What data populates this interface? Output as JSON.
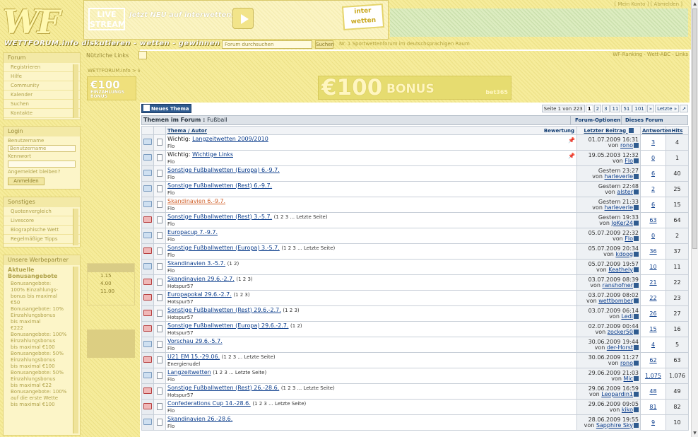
{
  "header": {
    "logo_text": "WF",
    "tagline": "WETTFORUM.info diskutieren - wetten - gewinnen",
    "live_stream": "LIVE STREAM",
    "promo_text": "Jetzt NEU auf interwetten.com",
    "interwetten": "inter wetten",
    "user_links": "[ Mein Konto ]   [ Abmelden ]"
  },
  "navbar": {
    "search_placeholder": "Forum durchsuchen",
    "search_button": "Suchen",
    "slogan": "Nr. 1 Sportwettenforum im deutschsprachigen Raum"
  },
  "sidebar": {
    "forum_title": "Forum",
    "forum_items": [
      "Registrieren",
      "Hilfe",
      "Community",
      "Kalender",
      "Suchen",
      "Kontakte"
    ],
    "login_title": "Login",
    "username_label": "Benutzername",
    "username_placeholder": "Benutzername",
    "password_label": "Kennwort",
    "remember_label": "Angemeldet bleiben?",
    "login_button": "Anmelden",
    "extras_title": "Sonstiges",
    "extras_items": [
      "Quotenvergleich",
      "Livescore",
      "Biographische Wett",
      "Regelmäßige Tipps"
    ],
    "offers_title": "Unsere Werbepartner",
    "offers_heading": "Aktuelle Bonusangebote",
    "offers_lines": [
      "Bonusangebote:",
      "100% Einzahlungs-",
      "bonus bis maximal",
      "€50",
      "Bonusangebote: 10%",
      "Einzahlungsbonus",
      "bis maximal",
      "€222",
      "Bonusangebote: 100%",
      "Einzahlungsbonus",
      "bis maximal €100",
      "Bonusangebote: 50%",
      "Einzahlungsbonus",
      "bis maximal €100",
      "Bonusangebote: 50%",
      "Einzahlungsbonus",
      "bis maximal €22",
      "Bonusangebote: 100%",
      "auf die erste Wette",
      "bis maximal €100"
    ]
  },
  "midcol": {
    "link_bar": "Nützliche Links",
    "bonus_amount": "€100",
    "bonus_text": "EINZAHLUNGS BONUS",
    "poll_options": [
      "1.15",
      "4.00",
      "11.00"
    ]
  },
  "breadcrumb": {
    "text": "WETTFORUM.info > Wettforum > Fußball",
    "top_links": "WF-Ranking - Wett-ABC - Links"
  },
  "banner": {
    "amount": "€100",
    "bonus": "BONUS",
    "brand": "bet365"
  },
  "forum": {
    "new_thread": "Neues Thema",
    "pager": {
      "info": "Seite 1 von 223",
      "pages": [
        "1",
        "2",
        "3",
        "11",
        "51",
        "101"
      ],
      "next": "»",
      "last": "Letzte »"
    },
    "title_prefix": "Themen im Forum",
    "title_forum": "Fußball",
    "options": "Forum-Optionen",
    "search": "Dieses Forum durchsuchen",
    "columns": {
      "topic": "Thema",
      "author": "Autor",
      "rating": "Bewertung",
      "last_post": "Letzter Beitrag",
      "replies": "Antworten",
      "views": "Hits"
    },
    "threads": [
      {
        "prefix": "Wichtig:",
        "title": "Langzeitwetten 2009/2010",
        "author": "Flo",
        "pages": "",
        "last_date": "01.07.2009 16:31",
        "last_by": "von",
        "last_user": "rono",
        "replies": "3",
        "views": "4",
        "hot": false,
        "sticky": true,
        "visited": false
      },
      {
        "prefix": "Wichtig:",
        "title": "Wichtige Links",
        "author": "Flo",
        "pages": "",
        "last_date": "19.05.2003 12:32",
        "last_by": "von",
        "last_user": "Flo",
        "replies": "0",
        "views": "1",
        "hot": false,
        "sticky": true,
        "visited": false
      },
      {
        "prefix": "",
        "title": "Sonstige Fußballwetten (Europa) 6.-9.7.",
        "author": "Flo",
        "pages": "",
        "last_date": "Gestern 23:27",
        "last_by": "von",
        "last_user": "harleverle",
        "replies": "6",
        "views": "40",
        "hot": false,
        "sticky": false,
        "visited": false
      },
      {
        "prefix": "",
        "title": "Sonstige Fußballwetten (Rest) 6.-9.7.",
        "author": "Flo",
        "pages": "",
        "last_date": "Gestern 22:48",
        "last_by": "von",
        "last_user": "alster",
        "replies": "2",
        "views": "25",
        "hot": false,
        "sticky": false,
        "visited": false
      },
      {
        "prefix": "",
        "title": "Skandinavien 6.-9.7.",
        "author": "Flo",
        "pages": "",
        "last_date": "Gestern 21:33",
        "last_by": "von",
        "last_user": "harleverle",
        "replies": "6",
        "views": "15",
        "hot": false,
        "sticky": false,
        "visited": true
      },
      {
        "prefix": "",
        "title": "Sonstige Fußballwetten (Rest) 3.-5.7.",
        "author": "Flo",
        "pages": "(1 2 3 ... Letzte Seite)",
        "last_date": "Gestern 19:33",
        "last_by": "von",
        "last_user": "JoKer24",
        "replies": "63",
        "views": "64",
        "hot": true,
        "sticky": false,
        "visited": false
      },
      {
        "prefix": "",
        "title": "Europacup 7.-9.7.",
        "author": "Flo",
        "pages": "",
        "last_date": "05.07.2009 22:32",
        "last_by": "von",
        "last_user": "Flo",
        "replies": "0",
        "views": "2",
        "hot": false,
        "sticky": false,
        "visited": false
      },
      {
        "prefix": "",
        "title": "Sonstige Fußballwetten (Europa) 3.-5.7.",
        "author": "Flo",
        "pages": "(1 2 3 ... Letzte Seite)",
        "last_date": "05.07.2009 20:34",
        "last_by": "von",
        "last_user": "kdoog",
        "replies": "36",
        "views": "37",
        "hot": true,
        "sticky": false,
        "visited": false
      },
      {
        "prefix": "",
        "title": "Skandinavien 3.-5.7.",
        "author": "Flo",
        "pages": "(1 2)",
        "last_date": "05.07.2009 19:57",
        "last_by": "von",
        "last_user": "Keathely",
        "replies": "10",
        "views": "11",
        "hot": false,
        "sticky": false,
        "visited": false
      },
      {
        "prefix": "",
        "title": "Skandinavien 29.6.-2.7.",
        "author": "Hotspur57",
        "pages": "(1 2 3)",
        "last_date": "03.07.2009 08:39",
        "last_by": "von",
        "last_user": "ranshofner",
        "replies": "21",
        "views": "22",
        "hot": true,
        "sticky": false,
        "visited": false
      },
      {
        "prefix": "",
        "title": "Europapokal 29.6.-2.7.",
        "author": "Hotspur57",
        "pages": "(1 2 3)",
        "last_date": "03.07.2009 08:02",
        "last_by": "von",
        "last_user": "wettbomber",
        "replies": "22",
        "views": "23",
        "hot": true,
        "sticky": false,
        "visited": false
      },
      {
        "prefix": "",
        "title": "Sonstige Fußballwetten (Rest) 29.6.-2.7.",
        "author": "Hotspur57",
        "pages": "(1 2 3)",
        "last_date": "03.07.2009 06:14",
        "last_by": "von",
        "last_user": "Ledi",
        "replies": "26",
        "views": "27",
        "hot": true,
        "sticky": false,
        "visited": false
      },
      {
        "prefix": "",
        "title": "Sonstige Fußballwetten (Europa) 29.6.-2.7.",
        "author": "Hotspur57",
        "pages": "(1 2)",
        "last_date": "02.07.2009 00:44",
        "last_by": "von",
        "last_user": "zocker50",
        "replies": "15",
        "views": "16",
        "hot": true,
        "sticky": false,
        "visited": false
      },
      {
        "prefix": "",
        "title": "Vorschau 29.6.-5.7.",
        "author": "Flo",
        "pages": "",
        "last_date": "30.06.2009 19:44",
        "last_by": "von",
        "last_user": "der-Horst",
        "replies": "4",
        "views": "5",
        "hot": false,
        "sticky": false,
        "visited": false
      },
      {
        "prefix": "",
        "title": "U21 EM 15.-29.06.",
        "author": "Energienudel",
        "pages": "(1 2 3 ... Letzte Seite)",
        "last_date": "30.06.2009 11:27",
        "last_by": "von",
        "last_user": "rono",
        "replies": "62",
        "views": "63",
        "hot": true,
        "sticky": false,
        "visited": false
      },
      {
        "prefix": "",
        "title": "Langzeitwetten",
        "author": "Flo",
        "pages": "(1 2 3 ... Letzte Seite)",
        "last_date": "29.06.2009 21:03",
        "last_by": "von",
        "last_user": "Mic",
        "replies": "1.075",
        "views": "1.076",
        "hot": false,
        "sticky": false,
        "visited": false
      },
      {
        "prefix": "",
        "title": "Sonstige Fußballwetten (Rest) 26.-28.6.",
        "author": "Hotspur57",
        "pages": "(1 2 3 ... Letzte Seite)",
        "last_date": "29.06.2009 16:59",
        "last_by": "von",
        "last_user": "Leopardin1",
        "replies": "48",
        "views": "49",
        "hot": true,
        "sticky": false,
        "visited": false
      },
      {
        "prefix": "",
        "title": "Confederations Cup 14.-28.6.",
        "author": "Flo",
        "pages": "(1 2 3 ... Letzte Seite)",
        "last_date": "29.06.2009 09:05",
        "last_by": "von",
        "last_user": "kiko",
        "replies": "81",
        "views": "82",
        "hot": true,
        "sticky": false,
        "visited": false
      },
      {
        "prefix": "",
        "title": "Skandinavien 26.-28.6.",
        "author": "Flo",
        "pages": "",
        "last_date": "28.06.2009 19:55",
        "last_by": "von",
        "last_user": "Sapphire Sky",
        "replies": "9",
        "views": "10",
        "hot": false,
        "sticky": false,
        "visited": false
      }
    ]
  }
}
